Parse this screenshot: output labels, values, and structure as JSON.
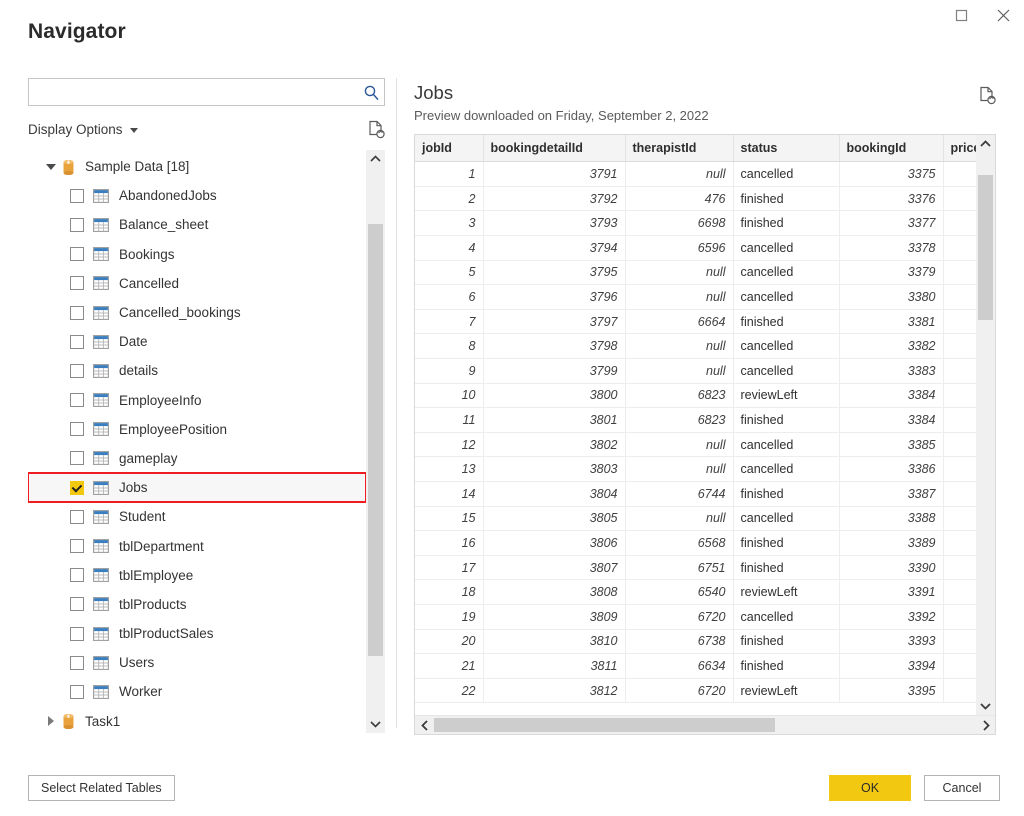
{
  "window": {
    "title": "Navigator",
    "controls": [
      {
        "name": "maximize-button",
        "glyph": "maximize"
      },
      {
        "name": "close-button",
        "glyph": "close"
      }
    ]
  },
  "left_panel": {
    "search": {
      "value": "",
      "placeholder": "",
      "icon": "search-icon"
    },
    "display_options_label": "Display Options",
    "refresh_icon": "refresh-document-icon",
    "tree": {
      "groups": [
        {
          "label": "Sample Data [18]",
          "expanded": true,
          "icon": "database-icon",
          "items": [
            {
              "label": "AbandonedJobs",
              "checked": false,
              "selected": false
            },
            {
              "label": "Balance_sheet",
              "checked": false,
              "selected": false
            },
            {
              "label": "Bookings",
              "checked": false,
              "selected": false
            },
            {
              "label": "Cancelled",
              "checked": false,
              "selected": false
            },
            {
              "label": "Cancelled_bookings",
              "checked": false,
              "selected": false
            },
            {
              "label": "Date",
              "checked": false,
              "selected": false
            },
            {
              "label": "details",
              "checked": false,
              "selected": false
            },
            {
              "label": "EmployeeInfo",
              "checked": false,
              "selected": false
            },
            {
              "label": "EmployeePosition",
              "checked": false,
              "selected": false
            },
            {
              "label": "gameplay",
              "checked": false,
              "selected": false
            },
            {
              "label": "Jobs",
              "checked": true,
              "selected": true
            },
            {
              "label": "Student",
              "checked": false,
              "selected": false
            },
            {
              "label": "tblDepartment",
              "checked": false,
              "selected": false
            },
            {
              "label": "tblEmployee",
              "checked": false,
              "selected": false
            },
            {
              "label": "tblProducts",
              "checked": false,
              "selected": false
            },
            {
              "label": "tblProductSales",
              "checked": false,
              "selected": false
            },
            {
              "label": "Users",
              "checked": false,
              "selected": false
            },
            {
              "label": "Worker",
              "checked": false,
              "selected": false
            }
          ]
        },
        {
          "label": "Task1",
          "expanded": false,
          "icon": "database-icon",
          "items": []
        }
      ]
    }
  },
  "preview": {
    "title": "Jobs",
    "subtitle": "Preview downloaded on Friday, September 2, 2022",
    "refresh_icon": "refresh-document-icon",
    "columns": [
      "jobId",
      "bookingdetailId",
      "therapistId",
      "status",
      "bookingId",
      "price"
    ],
    "rows": [
      [
        "1",
        "3791",
        "null",
        "cancelled",
        "3375",
        ""
      ],
      [
        "2",
        "3792",
        "476",
        "finished",
        "3376",
        ""
      ],
      [
        "3",
        "3793",
        "6698",
        "finished",
        "3377",
        ""
      ],
      [
        "4",
        "3794",
        "6596",
        "cancelled",
        "3378",
        ""
      ],
      [
        "5",
        "3795",
        "null",
        "cancelled",
        "3379",
        ""
      ],
      [
        "6",
        "3796",
        "null",
        "cancelled",
        "3380",
        ""
      ],
      [
        "7",
        "3797",
        "6664",
        "finished",
        "3381",
        ""
      ],
      [
        "8",
        "3798",
        "null",
        "cancelled",
        "3382",
        ""
      ],
      [
        "9",
        "3799",
        "null",
        "cancelled",
        "3383",
        ""
      ],
      [
        "10",
        "3800",
        "6823",
        "reviewLeft",
        "3384",
        ""
      ],
      [
        "11",
        "3801",
        "6823",
        "finished",
        "3384",
        ""
      ],
      [
        "12",
        "3802",
        "null",
        "cancelled",
        "3385",
        ""
      ],
      [
        "13",
        "3803",
        "null",
        "cancelled",
        "3386",
        ""
      ],
      [
        "14",
        "3804",
        "6744",
        "finished",
        "3387",
        ""
      ],
      [
        "15",
        "3805",
        "null",
        "cancelled",
        "3388",
        ""
      ],
      [
        "16",
        "3806",
        "6568",
        "finished",
        "3389",
        ""
      ],
      [
        "17",
        "3807",
        "6751",
        "finished",
        "3390",
        ""
      ],
      [
        "18",
        "3808",
        "6540",
        "reviewLeft",
        "3391",
        ""
      ],
      [
        "19",
        "3809",
        "6720",
        "cancelled",
        "3392",
        ""
      ],
      [
        "20",
        "3810",
        "6738",
        "finished",
        "3393",
        ""
      ],
      [
        "21",
        "3811",
        "6634",
        "finished",
        "3394",
        ""
      ],
      [
        "22",
        "3812",
        "6720",
        "reviewLeft",
        "3395",
        ""
      ]
    ]
  },
  "footer": {
    "select_related_label": "Select Related Tables",
    "ok_label": "OK",
    "cancel_label": "Cancel"
  },
  "colors": {
    "accent_yellow": "#f2c811",
    "selection_outline": "#ee1d22",
    "table_icon_header": "#3a7ebf",
    "database_icon": "#e8a33d"
  }
}
